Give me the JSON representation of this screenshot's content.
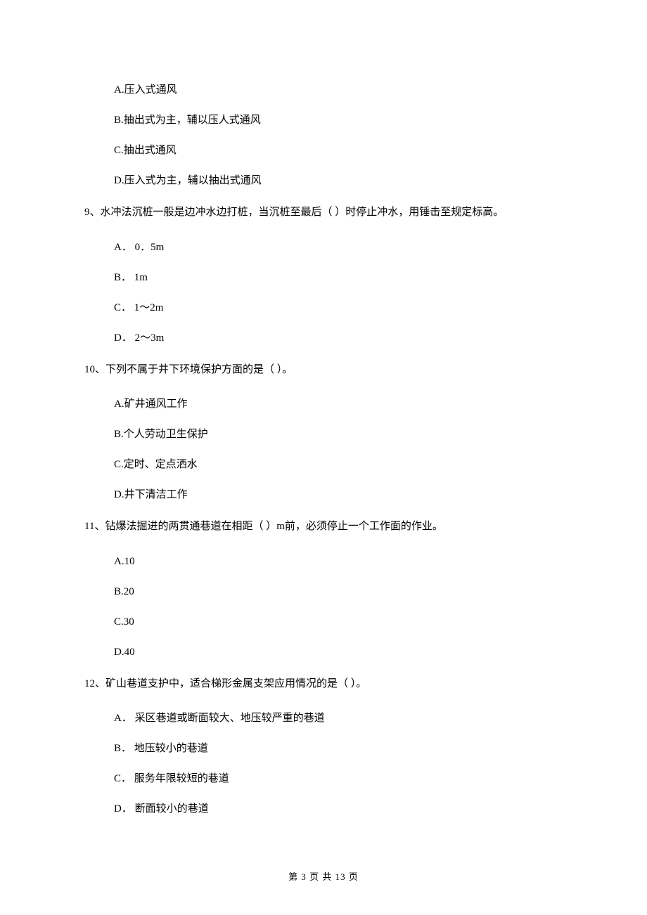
{
  "options_top": [
    "A.压入式通风",
    "B.抽出式为主，辅以压人式通风",
    "C.抽出式通风",
    "D.压入式为主，辅以抽出式通风"
  ],
  "q9": {
    "text": "9、水冲法沉桩一般是边冲水边打桩，当沉桩至最后（    ）时停止冲水，用锤击至规定标高。",
    "options": [
      "A． 0．5m",
      "B． 1m",
      "C． 1～2m",
      "D． 2～3m"
    ]
  },
  "q10": {
    "text": "10、下列不属于井下环境保护方面的是（    ）。",
    "options": [
      "A.矿井通风工作",
      "B.个人劳动卫生保护",
      "C.定时、定点洒水",
      "D.井下清洁工作"
    ]
  },
  "q11": {
    "text": "11、钻爆法掘进的两贯通巷道在相距（  ）m前，必须停止一个工作面的作业。",
    "options": [
      "A.10",
      "B.20",
      "C.30",
      "D.40"
    ]
  },
  "q12": {
    "text": "12、矿山巷道支护中，适合梯形金属支架应用情况的是（    ）。",
    "options": [
      "A． 采区巷道或断面较大、地压较严重的巷道",
      "B． 地压较小的巷道",
      "C． 服务年限较短的巷道",
      "D． 断面较小的巷道"
    ]
  },
  "footer": "第 3 页 共 13 页"
}
